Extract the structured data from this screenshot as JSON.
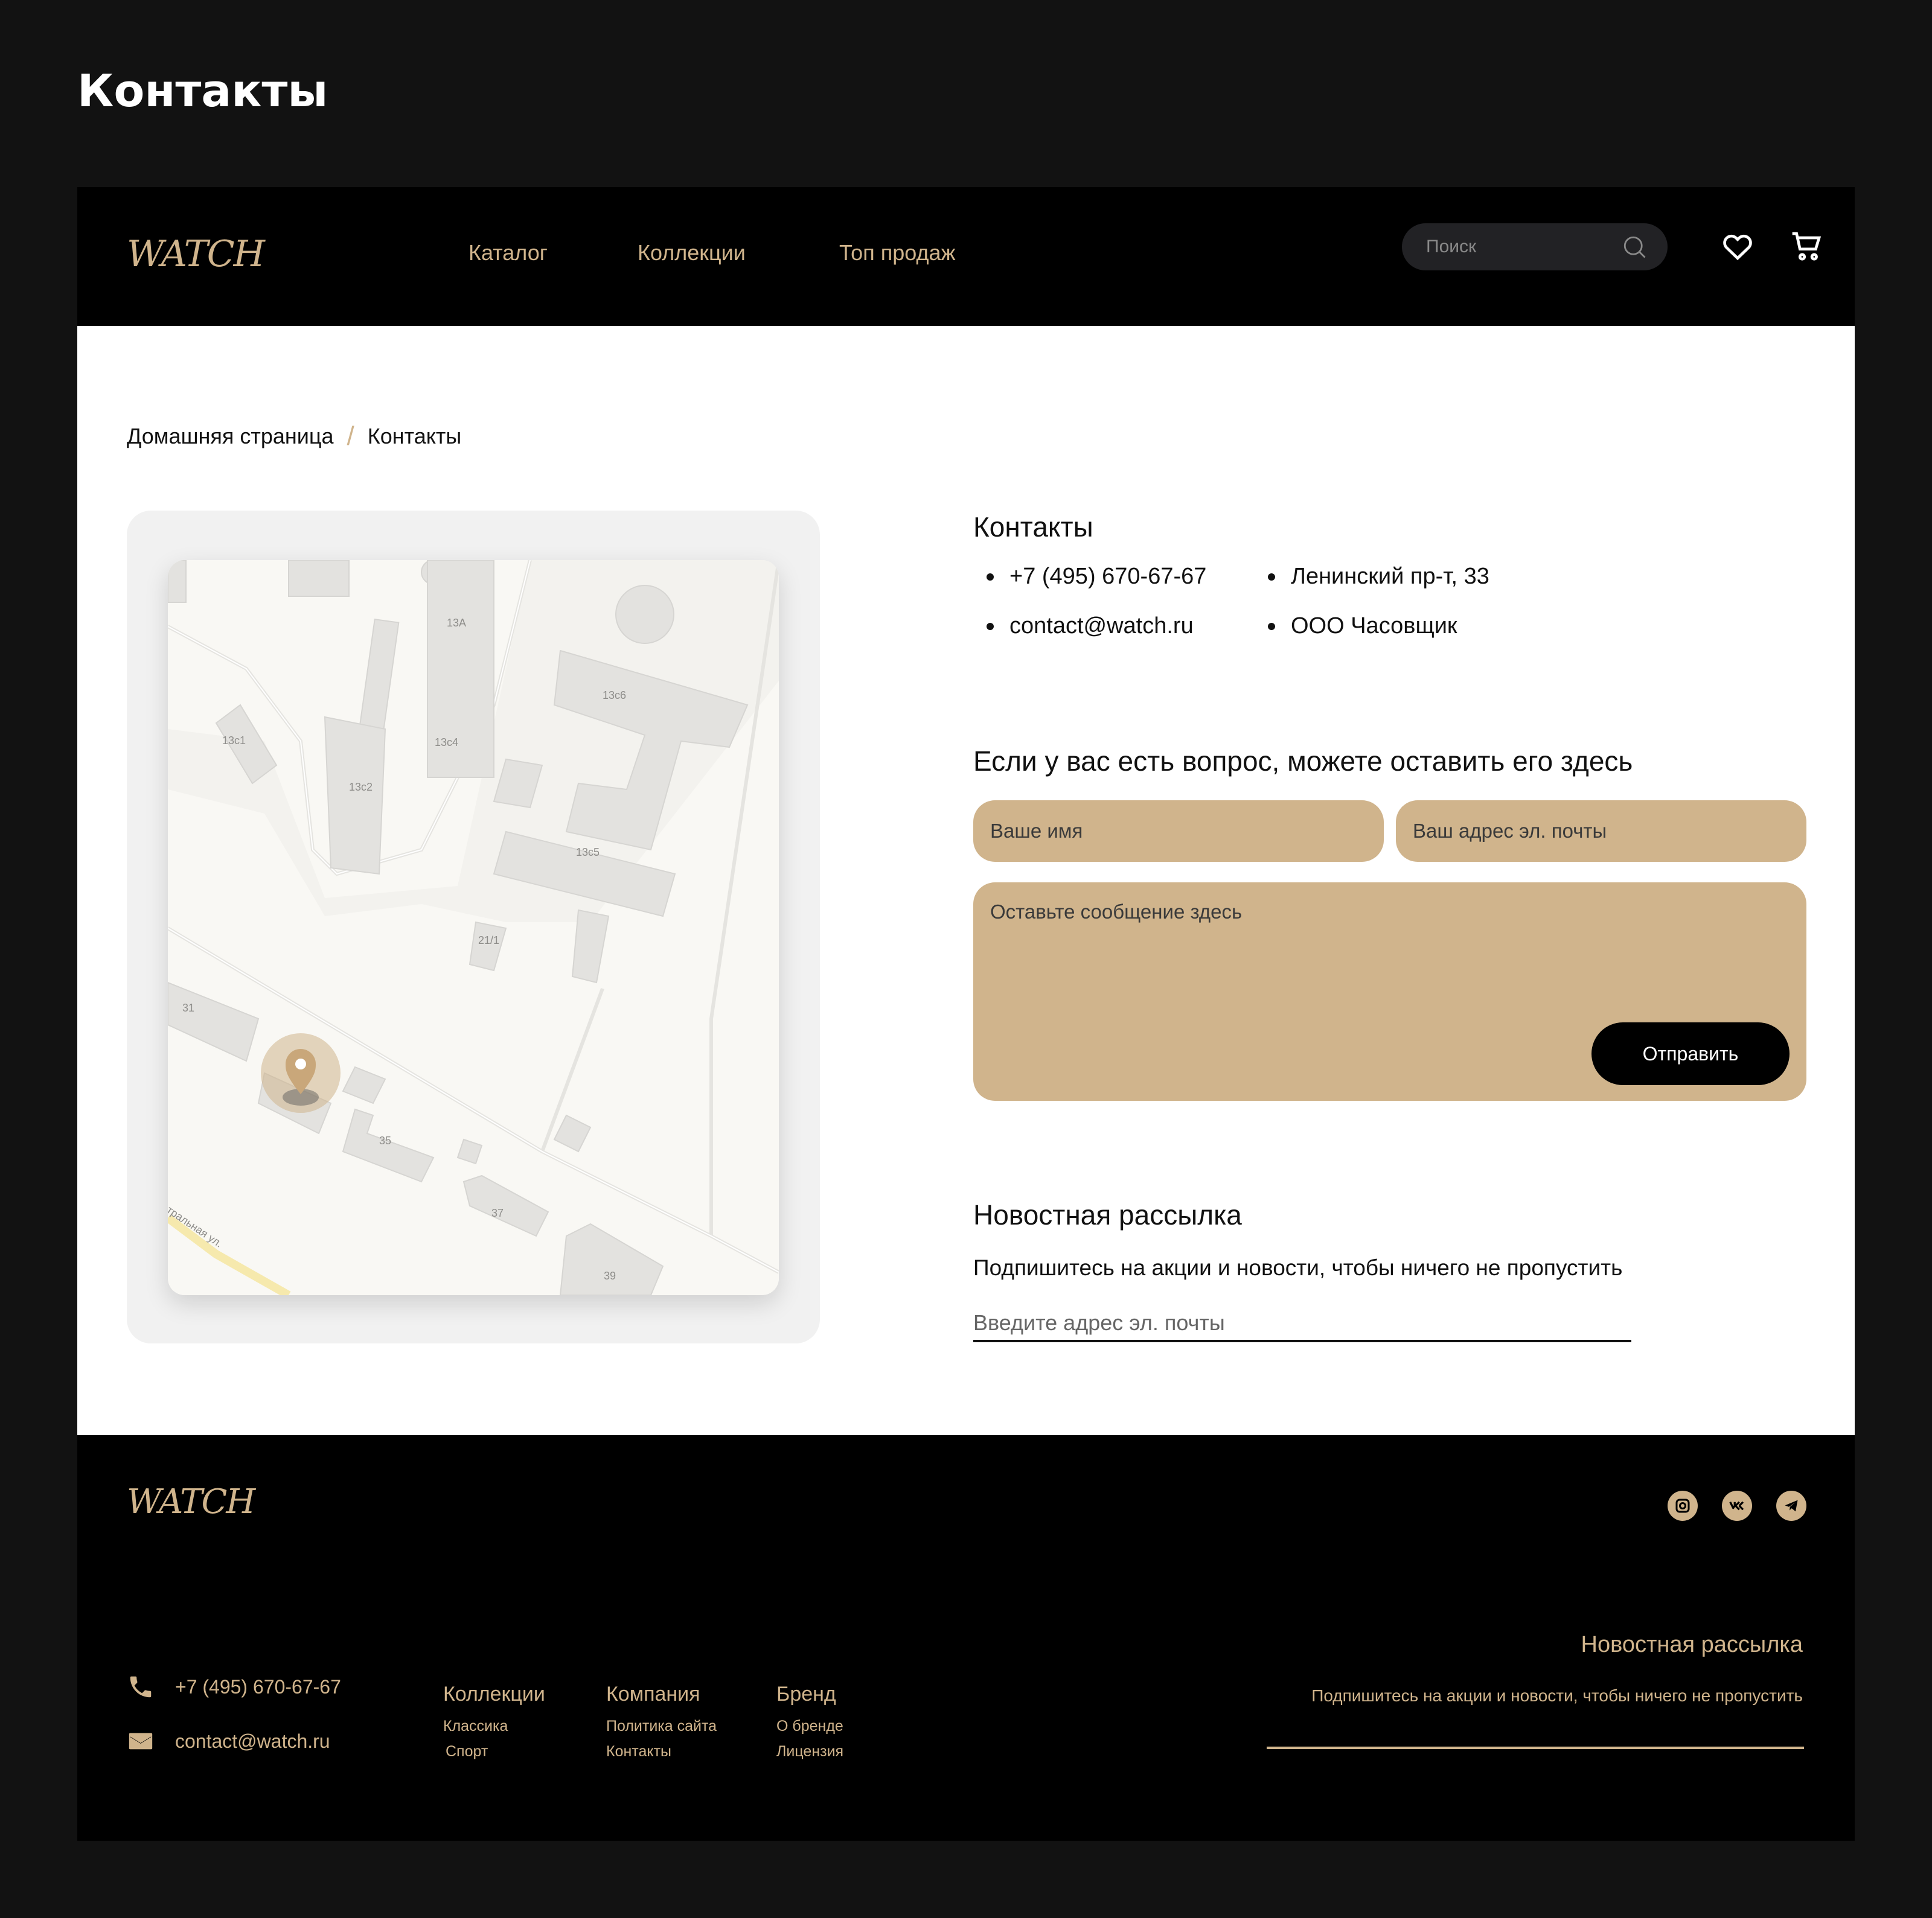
{
  "page": {
    "heading": "Контакты"
  },
  "header": {
    "logo": "WATCH",
    "nav": [
      "Каталог",
      "Коллекции",
      "Топ продаж"
    ],
    "search_placeholder": "Поиск"
  },
  "breadcrumb": {
    "home": "Домашняя страница",
    "separator": "/",
    "current": "Контакты"
  },
  "map": {
    "labels": [
      "13А",
      "13с6",
      "13с1",
      "13с4",
      "13с2",
      "13с5",
      "21/1",
      "31",
      "35",
      "37",
      "39",
      "тральная ул."
    ]
  },
  "contacts": {
    "title": "Контакты",
    "phone": "+7 (495) 670-67-67",
    "address": "Ленинский пр-т, 33",
    "email": "contact@watch.ru",
    "company": "ООО Часовщик"
  },
  "question_form": {
    "title": "Если у вас есть вопрос,  можете оставить его здесь",
    "name_placeholder": "Ваше имя",
    "email_placeholder": "Ваш адрес эл. почты",
    "message_placeholder": "Оставьте сообщение здесь",
    "submit_label": "Отправить"
  },
  "newsletter": {
    "title": "Новостная рассылка",
    "subtitle": "Подпишитесь на акции и новости, чтобы ничего не пропустить",
    "placeholder": "Введите адрес эл. почты"
  },
  "footer": {
    "logo": "WATCH",
    "socials": [
      "instagram-icon",
      "vk-icon",
      "telegram-icon"
    ],
    "phone": "+7 (495) 670-67-67",
    "email": "contact@watch.ru",
    "columns": [
      {
        "title": "Коллекции",
        "links": [
          "Классика",
          "Спорт"
        ]
      },
      {
        "title": "Компания",
        "links": [
          "Политика сайта",
          "Контакты"
        ]
      },
      {
        "title": "Бренд",
        "links": [
          "О бренде",
          "Лицензия"
        ]
      }
    ],
    "newsletter_title": "Новостная рассылка",
    "newsletter_subtitle": "Подпишитесь на акции и новости, чтобы ничего не пропустить"
  },
  "colors": {
    "accent": "#d0b48c",
    "page_bg": "#121212",
    "header_bg": "#000000"
  }
}
